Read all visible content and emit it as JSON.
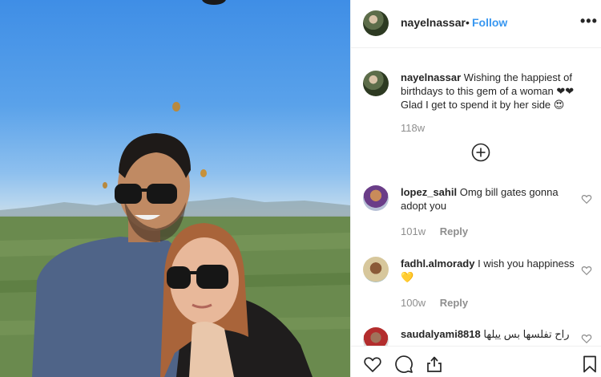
{
  "post": {
    "username": "nayelnassar",
    "separator": "•",
    "follow_label": "Follow",
    "more_label": "•••",
    "caption": {
      "username": "nayelnassar",
      "text": "Wishing the happiest of birthdays to this gem of a woman ❤❤ Glad I get to spend it by her side 😍",
      "time": "118w"
    }
  },
  "comments": [
    {
      "username": "lopez_sahil",
      "text": "Omg bill gates gonna adopt you",
      "time": "101w",
      "reply_label": "Reply"
    },
    {
      "username": "fadhl.almorady",
      "text": "I wish you happiness💛",
      "time": "100w",
      "reply_label": "Reply"
    },
    {
      "username": "saudalyami8818",
      "text": "راح تفلسها بس ييلها",
      "time": "",
      "reply_label": ""
    }
  ],
  "icons": {
    "load_more": "plus-circle-icon",
    "like": "heart-icon",
    "comment": "comment-icon",
    "share": "share-icon",
    "save": "bookmark-icon"
  },
  "colors": {
    "link_blue": "#3897f0",
    "text": "#262626",
    "muted": "#8e8e8e",
    "border": "#efefef"
  }
}
